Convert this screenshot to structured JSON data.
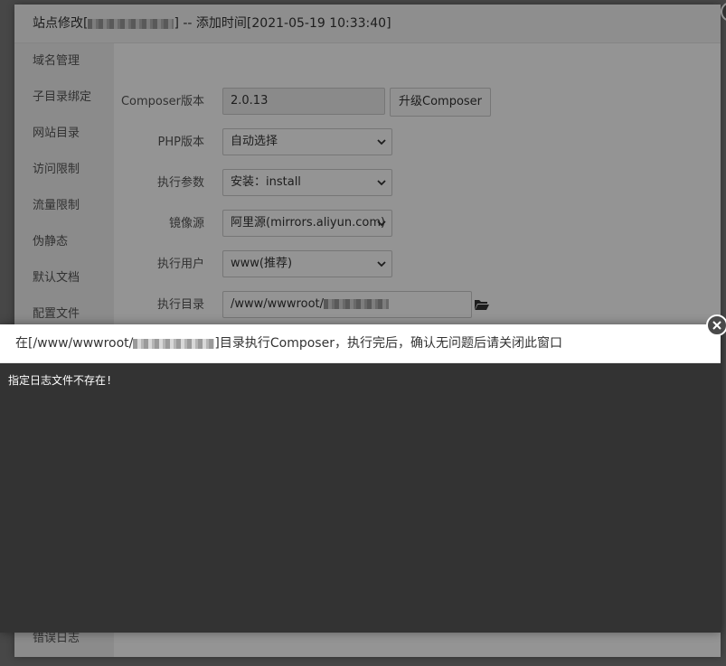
{
  "site_dialog": {
    "title_prefix": "站点修改[",
    "title_suffix": "] -- 添加时间[2021-05-19 10:33:40]",
    "sidebar": {
      "items": [
        {
          "label": "域名管理"
        },
        {
          "label": "子目录绑定"
        },
        {
          "label": "网站目录"
        },
        {
          "label": "访问限制"
        },
        {
          "label": "流量限制"
        },
        {
          "label": "伪静态"
        },
        {
          "label": "默认文档"
        },
        {
          "label": "配置文件"
        }
      ],
      "bottom_item": "错误日志"
    },
    "form": {
      "composer_version_label": "Composer版本",
      "composer_version_value": "2.0.13",
      "upgrade_button": "升级Composer",
      "php_version_label": "PHP版本",
      "php_version_value": "自动选择",
      "exec_args_label": "执行参数",
      "exec_args_value": "安装：install",
      "mirror_label": "镜像源",
      "mirror_value": "阿里源(mirrors.aliyun.com)",
      "exec_user_label": "执行用户",
      "exec_user_value": "www(推荐)",
      "exec_dir_label": "执行目录",
      "exec_dir_value": "/www/wwwroot/"
    }
  },
  "composer_dialog": {
    "title_prefix": "在[/www/wwwroot/",
    "title_suffix": "]目录执行Composer，执行完后，确认无问题后请关闭此窗口",
    "log_text": "指定日志文件不存在!"
  },
  "icons": {
    "close": "close-icon",
    "folder": "folder-open-icon",
    "select_arrow": "chevron-down-icon"
  }
}
